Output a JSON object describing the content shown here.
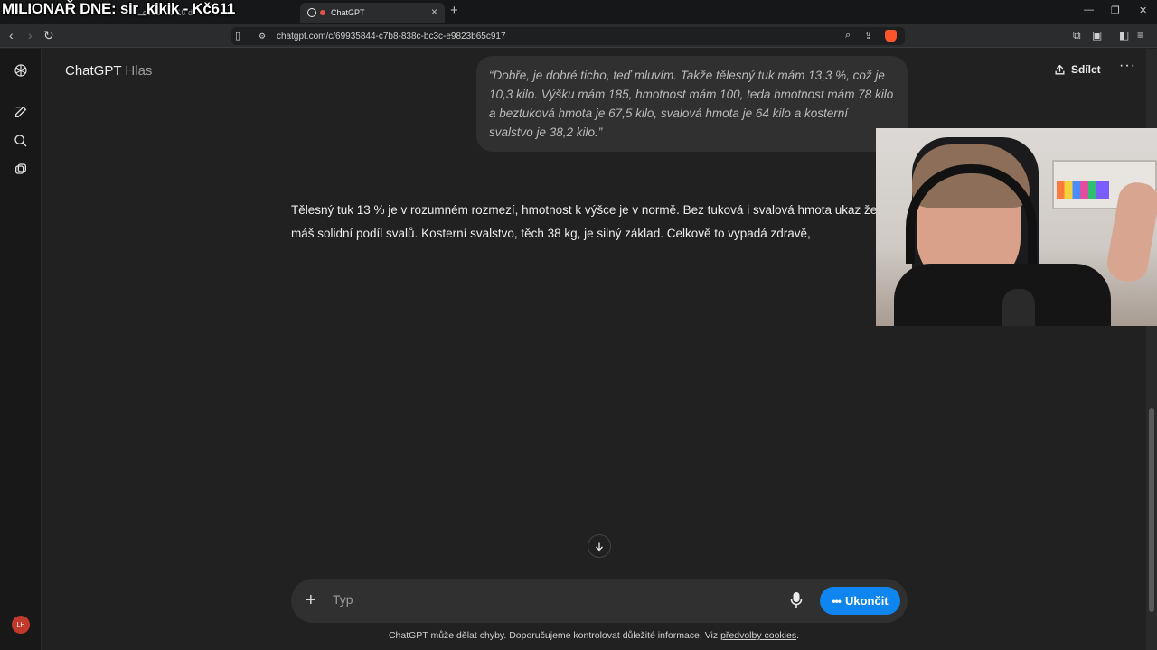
{
  "overlay": {
    "title": "MILIONAŘ DNE: sir_kikik - Kč611"
  },
  "browser": {
    "tabs": [
      {
        "label": "…",
        "active": false
      },
      {
        "label": "ChatGPT",
        "active": true
      }
    ],
    "inactive_tab_text": "ovědˇ na 10 d",
    "url": "chatgpt.com/c/69935844-c7b8-838c-bc3c-e9823b65c917"
  },
  "header": {
    "title": "ChatGPT",
    "subtitle": "Hlas",
    "share_label": "Sdílet"
  },
  "conversation": {
    "user_message": "“Dobře, je dobré ticho, teď mluvím. Takže tělesný tuk mám 13,3 %, což je 10,3 kilo. Výšku mám 185, hmotnost mám 100, teda hmotnost mám 78 kilo a beztuková hmota je 67,5 kilo, svalová hmota je 64 kilo a kosterní svalstvo je 38,2 kilo.”",
    "assistant_message": "Tělesný tuk 13 % je v rozumném rozmezí, hmotnost k výšce je v normě. Bez tuková i svalová hmota ukaz že máš solidní podíl svalů. Kosterní svalstvo, těch 38 kg, je silný základ. Celkově to vypadá zdravě,"
  },
  "composer": {
    "placeholder": "Typ",
    "end_button_label": "Ukončit"
  },
  "footer": {
    "text": "ChatGPT může dělat chyby. Doporučujeme kontrolovat důležité informace. Viz ",
    "link_text": "předvolby cookies",
    "suffix": "."
  },
  "sidebar": {
    "avatar_initials": "LH"
  },
  "colors": {
    "background": "#212121",
    "sidebar": "#181818",
    "bubble": "#303030",
    "accent": "#0f86ef",
    "avatar": "#c0392b"
  }
}
